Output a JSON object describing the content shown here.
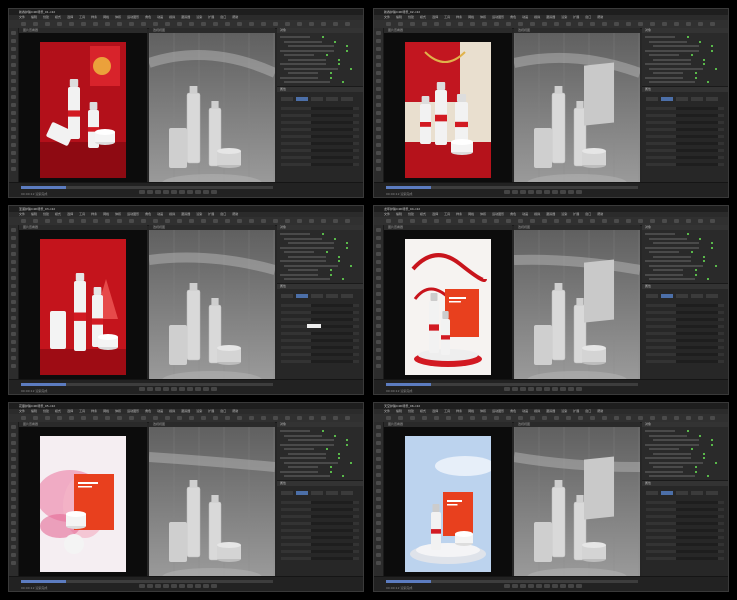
{
  "windows": [
    {
      "title": "新春护肤C4D场景_01.c4d",
      "theme": "red-newyear"
    },
    {
      "title": "新春护肤C4D场景_02.c4d",
      "theme": "red-gold"
    },
    {
      "title": "圣诞护肤C4D场景_03.c4d",
      "theme": "red-xmas"
    },
    {
      "title": "龙年护肤C4D场景_04.c4d",
      "theme": "dragon-white"
    },
    {
      "title": "花瓣护肤C4D场景_05.c4d",
      "theme": "pink-flower"
    },
    {
      "title": "天空护肤C4D场景_06.c4d",
      "theme": "blue-sky"
    }
  ],
  "menu": [
    "文件",
    "编辑",
    "创建",
    "模式",
    "选择",
    "工具",
    "样条",
    "网格",
    "体积",
    "运动图形",
    "角色",
    "动画",
    "模拟",
    "跟踪器",
    "渲染",
    "扩展",
    "窗口",
    "帮助"
  ],
  "viewport_label": "透视视图",
  "render_label": "图片查看器",
  "objects_label": "对象",
  "attributes_label": "属性",
  "status_text": "00:00:12  渲染完成",
  "colors": {
    "accent": "#4c6fa8",
    "ui_bg": "#262626",
    "red": "#c8141c"
  }
}
